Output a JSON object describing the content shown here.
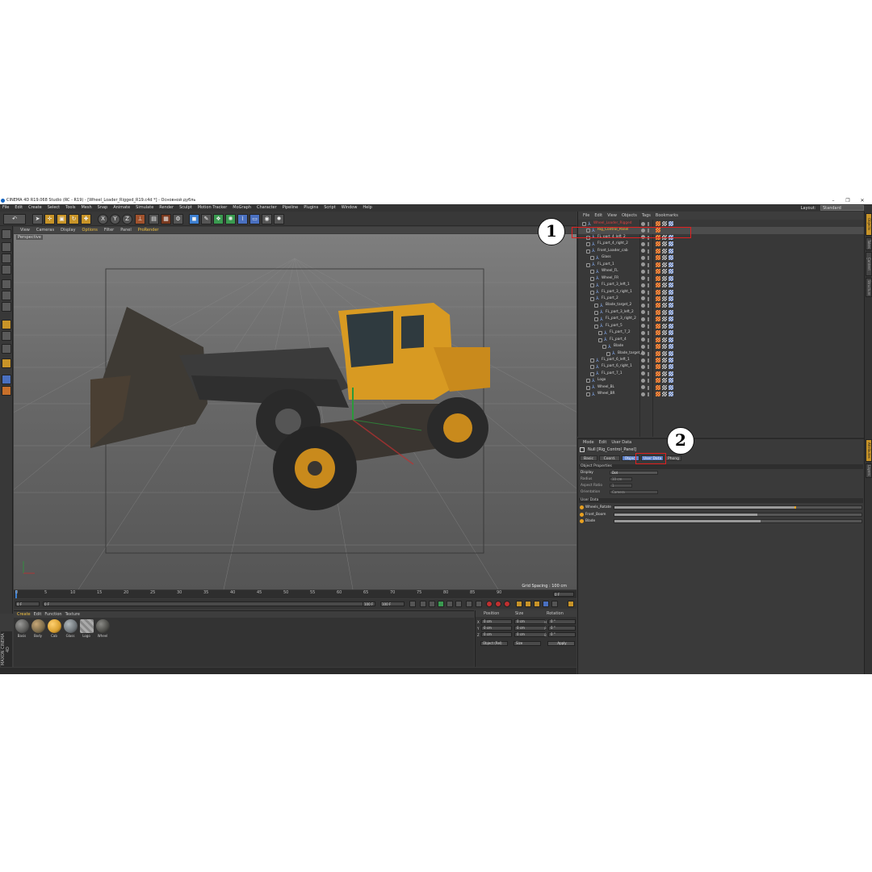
{
  "window": {
    "title": "CINEMA 4D R19.068 Studio (RC - R19) - [Wheel_Loader_Rigged_R19.c4d *] - Основной дубль"
  },
  "menubar": {
    "items": [
      "File",
      "Edit",
      "Create",
      "Select",
      "Tools",
      "Mesh",
      "Snap",
      "Animate",
      "Simulate",
      "Render",
      "Sculpt",
      "Motion Tracker",
      "MoGraph",
      "Character",
      "Pipeline",
      "Plugins",
      "Script",
      "Window",
      "Help"
    ],
    "layout_label": "Layout:",
    "layout_value": "Standard"
  },
  "toolbar": {
    "axis_x": "X",
    "axis_y": "Y",
    "axis_z": "Z"
  },
  "viewport": {
    "menu": [
      "View",
      "Cameras",
      "Display",
      "Options",
      "Filter",
      "Panel",
      "ProRender"
    ],
    "camera_label": "Perspective",
    "grid_spacing": "Grid Spacing : 100 cm"
  },
  "timeline": {
    "ticks": [
      "0",
      "5",
      "10",
      "15",
      "20",
      "25",
      "30",
      "35",
      "40",
      "45",
      "50",
      "55",
      "60",
      "65",
      "70",
      "75",
      "80",
      "85",
      "90"
    ],
    "frame_field": "0 F",
    "start_field": "0 F",
    "range_start": "0 F",
    "range_end": "100 F",
    "end_field": "100 F",
    "current_frame": "0 F"
  },
  "material_manager": {
    "menu": [
      "Create",
      "Edit",
      "Function",
      "Texture"
    ],
    "materials": [
      {
        "name": "Basis",
        "color": "#5a5a58"
      },
      {
        "name": "Body",
        "color": "#7a6a4a"
      },
      {
        "name": "Cab",
        "color": "#d9a030"
      },
      {
        "name": "Glass",
        "color": "#6e7478"
      },
      {
        "name": "Logo",
        "color": "#9a9a9a"
      },
      {
        "name": "Wheel",
        "color": "#4a4a46"
      }
    ]
  },
  "coordinates": {
    "headers": [
      "Position",
      "Size",
      "Rotation"
    ],
    "rows": [
      {
        "axis": "X",
        "pos": "0 cm",
        "size": "0 cm",
        "rot_axis": "H",
        "rot": "0 °"
      },
      {
        "axis": "Y",
        "pos": "0 cm",
        "size": "0 cm",
        "rot_axis": "P",
        "rot": "0 °"
      },
      {
        "axis": "Z",
        "pos": "0 cm",
        "size": "0 cm",
        "rot_axis": "B",
        "rot": "0 °"
      }
    ],
    "mode_select": "Object (Rel)",
    "size_select": "Size",
    "apply_label": "Apply"
  },
  "maxon": "MAXON CINEMA 4D",
  "object_manager": {
    "menu": [
      "File",
      "Edit",
      "View",
      "Objects",
      "Tags",
      "Bookmarks"
    ],
    "rows": [
      {
        "name": "Wheel_Loader_Rigged",
        "indent": 0,
        "color": "#e04040"
      },
      {
        "name": "Rig_Control_Panel",
        "indent": 1,
        "color": "#f0c040"
      },
      {
        "name": "FL_part_4_left_2",
        "indent": 1,
        "color": "#d8d8d8"
      },
      {
        "name": "FL_part_4_right_2",
        "indent": 1,
        "color": "#d8d8d8"
      },
      {
        "name": "Front_Loader_cab",
        "indent": 1,
        "color": "#d8d8d8"
      },
      {
        "name": "Glass",
        "indent": 2,
        "color": "#d8d8d8"
      },
      {
        "name": "FL_part_1",
        "indent": 1,
        "color": "#d8d8d8"
      },
      {
        "name": "Wheel_FL",
        "indent": 2,
        "color": "#d8d8d8"
      },
      {
        "name": "Wheel_FR",
        "indent": 2,
        "color": "#d8d8d8"
      },
      {
        "name": "FL_part_3_left_1",
        "indent": 2,
        "color": "#d8d8d8"
      },
      {
        "name": "FL_part_3_right_1",
        "indent": 2,
        "color": "#d8d8d8"
      },
      {
        "name": "FL_part_2",
        "indent": 2,
        "color": "#d8d8d8"
      },
      {
        "name": "Blade_target_2",
        "indent": 3,
        "color": "#d8d8d8"
      },
      {
        "name": "FL_part_3_left_2",
        "indent": 3,
        "color": "#d8d8d8"
      },
      {
        "name": "FL_part_3_right_2",
        "indent": 3,
        "color": "#d8d8d8"
      },
      {
        "name": "FL_part_5",
        "indent": 3,
        "color": "#d8d8d8"
      },
      {
        "name": "FL_part_7_2",
        "indent": 4,
        "color": "#d8d8d8"
      },
      {
        "name": "FL_part_4",
        "indent": 4,
        "color": "#d8d8d8"
      },
      {
        "name": "Blade",
        "indent": 5,
        "color": "#d8d8d8"
      },
      {
        "name": "Blade_target_1",
        "indent": 6,
        "color": "#d8d8d8"
      },
      {
        "name": "FL_part_6_left_1",
        "indent": 2,
        "color": "#d8d8d8"
      },
      {
        "name": "FL_part_6_right_1",
        "indent": 2,
        "color": "#d8d8d8"
      },
      {
        "name": "FL_part_7_1",
        "indent": 2,
        "color": "#d8d8d8"
      },
      {
        "name": "Logo",
        "indent": 1,
        "color": "#d8d8d8"
      },
      {
        "name": "Wheel_BL",
        "indent": 1,
        "color": "#d8d8d8"
      },
      {
        "name": "Wheel_BR",
        "indent": 1,
        "color": "#d8d8d8"
      }
    ]
  },
  "attribute_manager": {
    "menu": [
      "Mode",
      "Edit",
      "User Data"
    ],
    "header": "Null [Rig_Control_Panel]",
    "tabs": [
      "Basic",
      "Coord.",
      "Object",
      "User Data",
      "Phong"
    ],
    "active_tabs": [
      2,
      3
    ],
    "object_properties_title": "Object Properties",
    "props": [
      {
        "label": "Display",
        "value": "Dot"
      },
      {
        "label": "Radius",
        "value": "10 cm"
      },
      {
        "label": "Aspect Ratio",
        "value": "1"
      },
      {
        "label": "Orientation",
        "value": "Camera"
      }
    ],
    "user_data_title": "User Data",
    "user_data": [
      {
        "label": "Wheels_Rotate",
        "fill": 0.73
      },
      {
        "label": "Front_Boom",
        "fill": 0.58
      },
      {
        "label": "Blade",
        "fill": 0.59
      }
    ]
  },
  "right_strip_tabs": [
    "Objects",
    "Takes",
    "Content Browser",
    "Structure",
    "Attributes",
    "Layers"
  ],
  "callouts": [
    "1",
    "2"
  ]
}
